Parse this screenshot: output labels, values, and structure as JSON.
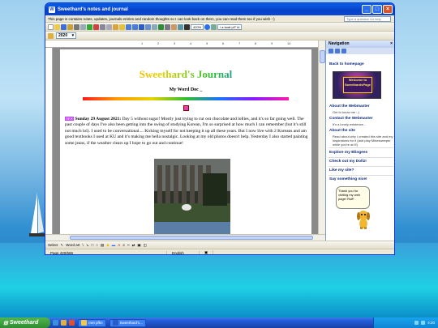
{
  "window": {
    "title": "Sweethard's notes and journal"
  },
  "menu": {
    "text": "This page is contains notes, updates, journals entries and random thoughts so I can look back on them, you can read them too if you wish :-)",
    "ask_placeholder": "Type a question for help"
  },
  "toolbar": {
    "zoom": "420%",
    "style": "i a boat ptT bl",
    "year": "2020"
  },
  "document": {
    "title": "Sweethard's Journal",
    "subtitle": "My Word Doc _",
    "entry_date": "Sunday 29 August 2021:",
    "entry_text": "Day 5 without sugar! Mostly just trying to cut out chocolate and lollies, and it's so far going well. The past couple of days I've also been getting into the swing of studying Korean, I'm so surprised at how much I can remember (but it's still not much lol). I used to be conversational.... Kicking myself for not keeping it up all these years. But I now live with 2 Koreans and am good textbooks I used at KU and it's making me hella nostalgic. Looking at my old photos doesn't help. Yesterday I also started painting some jeans, if the weather clears up I hope to go out and continue!"
  },
  "navigation": {
    "header": "Navigation",
    "back": "Back to homepage",
    "banner_text": "Welcome to SweethardsPage",
    "items": [
      {
        "label": "About the Webmaster",
        "sub": "Get to know me :-)"
      },
      {
        "label": "Contact the Webmaster",
        "sub": "It's a lonely existence..."
      },
      {
        "label": "About the site",
        "sub": "Read about why I created this site and my inspirations for it (and play Minesweeper while you're at it!)"
      },
      {
        "label": "Explore my Blingees",
        "sub": ""
      },
      {
        "label": "Check out my Dollz!",
        "sub": ""
      },
      {
        "label": "Like my site?",
        "sub": ""
      },
      {
        "label": "Say something nice!",
        "sub": ""
      }
    ],
    "bubble": "Thank you for visiting my web page! Ruff!"
  },
  "drawbar": {
    "select": "Select",
    "wordart": "Word art"
  },
  "status": {
    "page": "Page 420/666",
    "language": "English"
  },
  "taskbar": {
    "start": "Sweethard",
    "buttons": [
      "rnet pfkn",
      "Sweethard's..."
    ],
    "time": "4:20"
  }
}
